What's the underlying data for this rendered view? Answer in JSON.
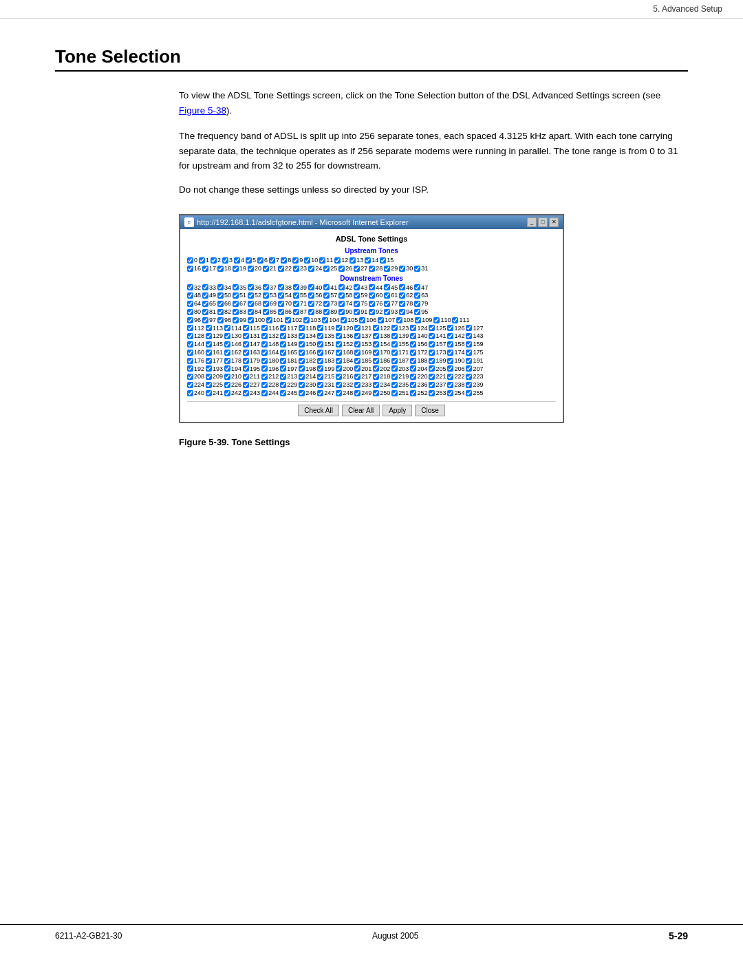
{
  "topbar": {
    "nav": "5. Advanced Setup"
  },
  "page": {
    "title": "Tone Selection",
    "intro1": "To view the ADSL Tone Settings screen, click on the Tone Selection button of the DSL Advanced Settings screen (see Figure 5-38).",
    "intro2": "The frequency band of ADSL is split up into 256 separate tones, each spaced 4.3125 kHz apart. With each tone carrying separate data, the technique operates as if 256 separate modems were running in parallel. The tone range is from 0 to 31 for upstream and from 32 to 255 for downstream.",
    "notice": "Do not change these settings unless so directed by your ISP.",
    "figure_caption": "Figure 5-39.   Tone Settings"
  },
  "browser": {
    "title": "http://192.168.1.1/adslcfgtone.html - Microsoft Internet Explorer",
    "adsl_title": "ADSL Tone Settings",
    "upstream_label": "Upstream Tones",
    "downstream_label": "Downstream Tones",
    "buttons": {
      "check_all": "Check All",
      "clear_all": "Clear All",
      "apply": "Apply",
      "close": "Close"
    }
  },
  "footer": {
    "left": "6211-A2-GB21-30",
    "center": "August 2005",
    "right": "5-29"
  }
}
